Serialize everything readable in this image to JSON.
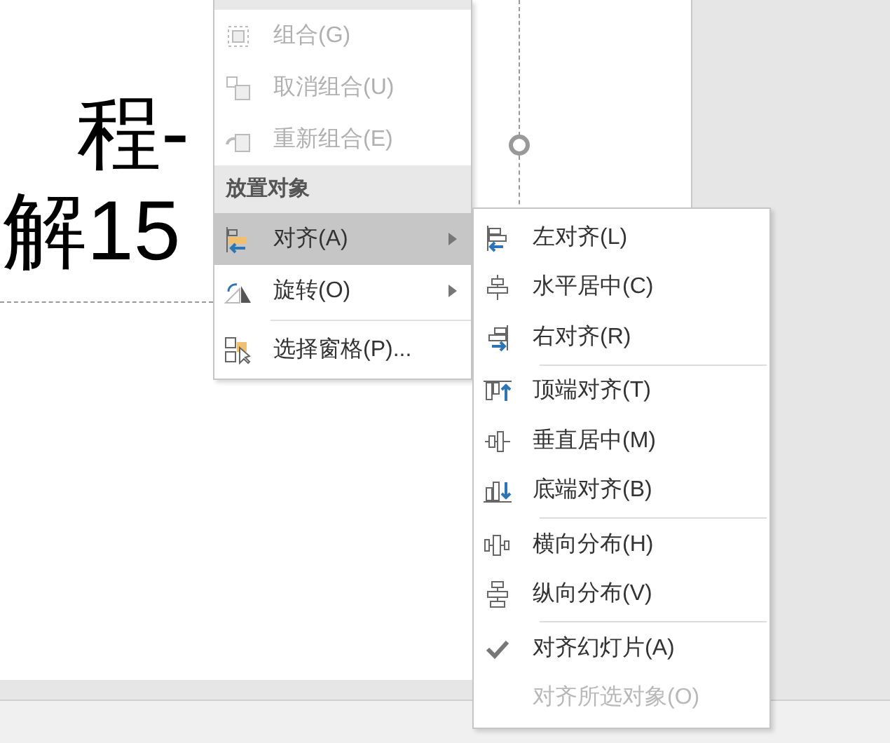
{
  "slide": {
    "title_lines": [
      "程-",
      "解15"
    ]
  },
  "context_menu": {
    "items": [
      {
        "kind": "item",
        "label": "组合(G)",
        "disabled": true,
        "selected": false,
        "submenu": false
      },
      {
        "kind": "item",
        "label": "取消组合(U)",
        "disabled": true,
        "selected": false,
        "submenu": false
      },
      {
        "kind": "item",
        "label": "重新组合(E)",
        "disabled": true,
        "selected": false,
        "submenu": false
      },
      {
        "kind": "header",
        "label": "放置对象"
      },
      {
        "kind": "item",
        "label": "对齐(A)",
        "disabled": false,
        "selected": true,
        "submenu": true
      },
      {
        "kind": "item",
        "label": "旋转(O)",
        "disabled": false,
        "selected": false,
        "submenu": true
      },
      {
        "kind": "separator"
      },
      {
        "kind": "item",
        "label": "选择窗格(P)...",
        "disabled": false,
        "selected": false,
        "submenu": false
      }
    ]
  },
  "align_submenu": {
    "items": [
      {
        "kind": "item",
        "label": "左对齐(L)",
        "disabled": false,
        "checked": false
      },
      {
        "kind": "item",
        "label": "水平居中(C)",
        "disabled": false,
        "checked": false
      },
      {
        "kind": "item",
        "label": "右对齐(R)",
        "disabled": false,
        "checked": false
      },
      {
        "kind": "separator"
      },
      {
        "kind": "item",
        "label": "顶端对齐(T)",
        "disabled": false,
        "checked": false
      },
      {
        "kind": "item",
        "label": "垂直居中(M)",
        "disabled": false,
        "checked": false
      },
      {
        "kind": "item",
        "label": "底端对齐(B)",
        "disabled": false,
        "checked": false
      },
      {
        "kind": "separator"
      },
      {
        "kind": "item",
        "label": "横向分布(H)",
        "disabled": false,
        "checked": false
      },
      {
        "kind": "item",
        "label": "纵向分布(V)",
        "disabled": false,
        "checked": false
      },
      {
        "kind": "separator"
      },
      {
        "kind": "item",
        "label": "对齐幻灯片(A)",
        "disabled": false,
        "checked": true
      },
      {
        "kind": "item",
        "label": "对齐所选对象(O)",
        "disabled": true,
        "checked": false
      }
    ]
  }
}
